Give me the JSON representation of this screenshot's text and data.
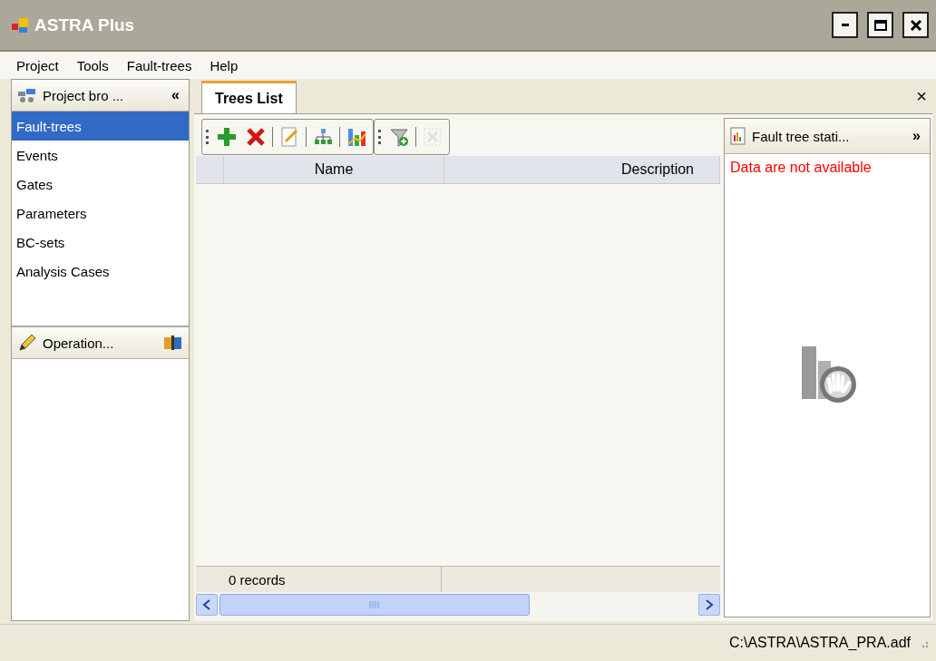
{
  "window": {
    "title": "ASTRA Plus"
  },
  "menu": [
    "Project",
    "Tools",
    "Fault-trees",
    "Help"
  ],
  "project_browser": {
    "title": "Project bro ...",
    "collapse": "«",
    "items": [
      {
        "label": "Fault-trees",
        "selected": true
      },
      {
        "label": "Events",
        "selected": false
      },
      {
        "label": "Gates",
        "selected": false
      },
      {
        "label": "Parameters",
        "selected": false
      },
      {
        "label": "BC-sets",
        "selected": false
      },
      {
        "label": "Analysis Cases",
        "selected": false
      }
    ]
  },
  "operations": {
    "title": "Operation..."
  },
  "tabs": [
    {
      "label": "Trees List",
      "selected": true
    }
  ],
  "close": "×",
  "toolbar": [
    [
      {
        "kind": "add",
        "disabled": false
      },
      {
        "kind": "delete",
        "disabled": false
      },
      {
        "kind": "edit",
        "disabled": false
      },
      {
        "kind": "tree",
        "disabled": false
      },
      {
        "kind": "chart",
        "disabled": false
      }
    ],
    [
      {
        "kind": "filter",
        "disabled": false
      },
      {
        "kind": "clear",
        "disabled": true
      }
    ]
  ],
  "table": {
    "columns": [
      "Name",
      "Description"
    ],
    "footer": "0 records"
  },
  "stats_panel": {
    "title": "Fault tree stati...",
    "expand": "»",
    "message": "Data are not available"
  },
  "status_bar": {
    "path": "C:\\ASTRA\\ASTRA_PRA.adf"
  }
}
